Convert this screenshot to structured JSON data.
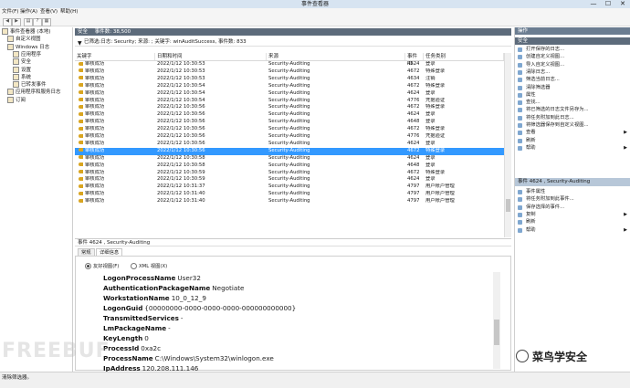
{
  "window": {
    "title": "事件查看器",
    "minimize": "—",
    "maximize": "☐",
    "close": "✕"
  },
  "menu": [
    "文件(F)",
    "操作(A)",
    "查看(V)",
    "帮助(H)"
  ],
  "tree": {
    "items": [
      {
        "label": "事件查看器 (本地)",
        "indent": 0
      },
      {
        "label": "自定义视图",
        "indent": 1
      },
      {
        "label": "Windows 日志",
        "indent": 1
      },
      {
        "label": "应用程序",
        "indent": 2
      },
      {
        "label": "安全",
        "indent": 2
      },
      {
        "label": "设置",
        "indent": 2
      },
      {
        "label": "系统",
        "indent": 2
      },
      {
        "label": "已转发事件",
        "indent": 2
      },
      {
        "label": "应用程序和服务日志",
        "indent": 1
      },
      {
        "label": "订阅",
        "indent": 1
      }
    ]
  },
  "log_header": {
    "name": "安全",
    "count": "事件数: 38,500"
  },
  "filter_text": "已筛选:日志: Security; 来源: ; 关键字: winAuditSuccess, 事件数: 833",
  "grid": {
    "columns": [
      "关键字",
      "日期和时间",
      "来源",
      "事件 ID",
      "任务类别"
    ],
    "rows": [
      [
        "审核成功",
        "2022/1/12 10:30:53",
        "Security-Auditing",
        "4624",
        "登录"
      ],
      [
        "审核成功",
        "2022/1/12 10:30:53",
        "Security-Auditing",
        "4672",
        "特殊登录"
      ],
      [
        "审核成功",
        "2022/1/12 10:30:53",
        "Security-Auditing",
        "4634",
        "注销"
      ],
      [
        "审核成功",
        "2022/1/12 10:30:54",
        "Security-Auditing",
        "4672",
        "特殊登录"
      ],
      [
        "审核成功",
        "2022/1/12 10:30:54",
        "Security-Auditing",
        "4624",
        "登录"
      ],
      [
        "审核成功",
        "2022/1/12 10:30:54",
        "Security-Auditing",
        "4776",
        "凭据验证"
      ],
      [
        "审核成功",
        "2022/1/12 10:30:56",
        "Security-Auditing",
        "4672",
        "特殊登录"
      ],
      [
        "审核成功",
        "2022/1/12 10:30:56",
        "Security-Auditing",
        "4624",
        "登录"
      ],
      [
        "审核成功",
        "2022/1/12 10:30:56",
        "Security-Auditing",
        "4648",
        "登录"
      ],
      [
        "审核成功",
        "2022/1/12 10:30:56",
        "Security-Auditing",
        "4672",
        "特殊登录"
      ],
      [
        "审核成功",
        "2022/1/12 10:30:56",
        "Security-Auditing",
        "4776",
        "凭据验证"
      ],
      [
        "审核成功",
        "2022/1/12 10:30:56",
        "Security-Auditing",
        "4624",
        "登录"
      ],
      [
        "审核成功",
        "2022/1/12 10:30:56",
        "Security-Auditing",
        "4672",
        "特殊登录"
      ],
      [
        "审核成功",
        "2022/1/12 10:30:58",
        "Security-Auditing",
        "4624",
        "登录"
      ],
      [
        "审核成功",
        "2022/1/12 10:30:58",
        "Security-Auditing",
        "4648",
        "登录"
      ],
      [
        "审核成功",
        "2022/1/12 10:30:59",
        "Security-Auditing",
        "4672",
        "特殊登录"
      ],
      [
        "审核成功",
        "2022/1/12 10:30:59",
        "Security-Auditing",
        "4624",
        "登录"
      ],
      [
        "审核成功",
        "2022/1/12 10:31:37",
        "Security-Auditing",
        "4797",
        "用户帐户管理"
      ],
      [
        "审核成功",
        "2022/1/12 10:31:40",
        "Security-Auditing",
        "4797",
        "用户帐户管理"
      ],
      [
        "审核成功",
        "2022/1/12 10:31:40",
        "Security-Auditing",
        "4797",
        "用户帐户管理"
      ]
    ],
    "selected_index": 12
  },
  "detail": {
    "header": "事件 4624 , Security-Auditing",
    "tabs": [
      "常规",
      "详细信息"
    ],
    "active_tab": 1,
    "radio_friendly": "友好视图(F)",
    "radio_xml": "XML 视图(X)",
    "lines": [
      {
        "key": "LogonProcessName",
        "value": "User32"
      },
      {
        "key": "AuthenticationPackageName",
        "value": "Negotiate"
      },
      {
        "key": "WorkstationName",
        "value": "10_0_12_9"
      },
      {
        "key": "LogonGuid",
        "value": "{00000000-0000-0000-0000-000000000000}"
      },
      {
        "key": "TransmittedServices",
        "value": "-"
      },
      {
        "key": "LmPackageName",
        "value": "-"
      },
      {
        "key": "KeyLength",
        "value": "0"
      },
      {
        "key": "ProcessId",
        "value": "0xa2c"
      },
      {
        "key": "ProcessName",
        "value": "C:\\Windows\\System32\\winlogon.exe"
      },
      {
        "key": "IpAddress",
        "value": "120.208.111.146"
      }
    ]
  },
  "actions": {
    "title": "操作",
    "section1": "安全",
    "items1": [
      {
        "label": "打开保存的日志...",
        "arrow": false
      },
      {
        "label": "创建自定义视图...",
        "arrow": false
      },
      {
        "label": "导入自定义视图...",
        "arrow": false
      },
      {
        "label": "清除日志...",
        "arrow": false
      },
      {
        "label": "筛选当前日志...",
        "arrow": false
      },
      {
        "label": "清除筛选器",
        "arrow": false
      },
      {
        "label": "属性",
        "arrow": false
      },
      {
        "label": "查找...",
        "arrow": false
      },
      {
        "label": "将已筛选的日志文件另存为...",
        "arrow": false
      },
      {
        "label": "将任务附加到此日志...",
        "arrow": false
      },
      {
        "label": "将筛选器保存到自定义视图...",
        "arrow": false
      },
      {
        "label": "查看",
        "arrow": true
      },
      {
        "label": "刷新",
        "arrow": false
      },
      {
        "label": "帮助",
        "arrow": true
      }
    ],
    "section2": "事件 4624 , Security-Auditing",
    "items2": [
      {
        "label": "事件属性",
        "arrow": false
      },
      {
        "label": "将任务附加到此事件...",
        "arrow": false
      },
      {
        "label": "保存选择的事件...",
        "arrow": false
      },
      {
        "label": "复制",
        "arrow": true
      },
      {
        "label": "刷新",
        "arrow": false
      },
      {
        "label": "帮助",
        "arrow": true
      }
    ]
  },
  "status": "清除筛选器。",
  "watermark": {
    "left": "FREEBUF",
    "right": "菜鸟学安全"
  },
  "colors": {
    "selection": "#3399ff",
    "section_header": "#6b7d91"
  }
}
